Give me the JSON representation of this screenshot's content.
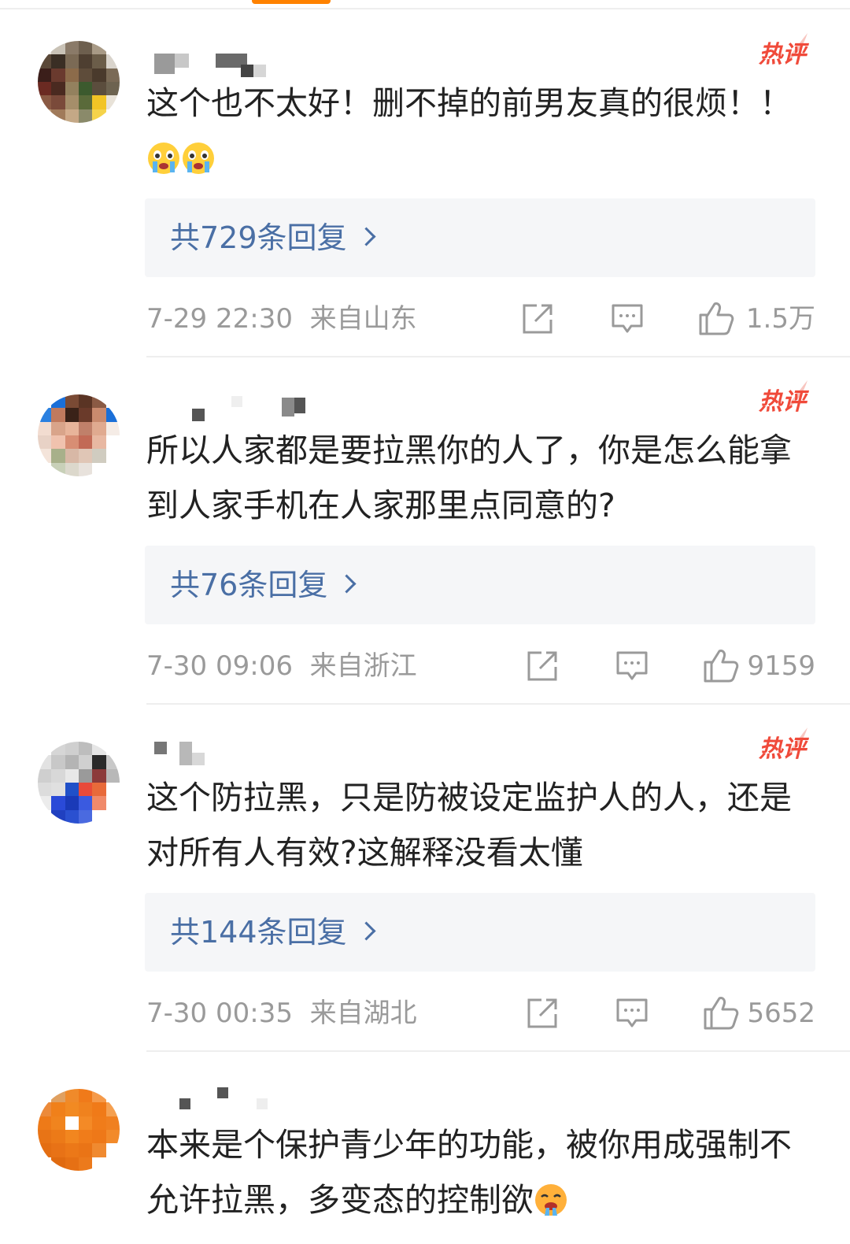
{
  "feed": {
    "comments": [
      {
        "hot_label": "热评",
        "text": "这个也不太好！删不掉的前男友真的很烦！！",
        "emoji": [
          "crying-face",
          "crying-face"
        ],
        "replies": "共729条回复",
        "time": "7-29 22:30",
        "location": "来自山东",
        "likes": "1.5万"
      },
      {
        "hot_label": "热评",
        "text": "所以人家都是要拉黑你的人了，你是怎么能拿到人家手机在人家那里点同意的?",
        "replies": "共76条回复",
        "time": "7-30 09:06",
        "location": "来自浙江",
        "likes": "9159"
      },
      {
        "hot_label": "热评",
        "text": "这个防拉黑，只是防被设定监护人的人，还是对所有人有效?这解释没看太懂",
        "replies": "共144条回复",
        "time": "7-30 00:35",
        "location": "来自湖北",
        "likes": "5652"
      },
      {
        "text": "本来是个保护青少年的功能，被你用成强制不允许拉黑，多变态的控制欲",
        "emoji": [
          "hot-face"
        ]
      }
    ]
  },
  "colors": {
    "accent": "#ff8200",
    "hot": "#f04a3a",
    "link": "#4a6fa5",
    "meta": "#9a9a9a",
    "text": "#222222"
  },
  "icons": [
    "share-icon",
    "comment-icon",
    "like-icon",
    "flame-icon"
  ]
}
